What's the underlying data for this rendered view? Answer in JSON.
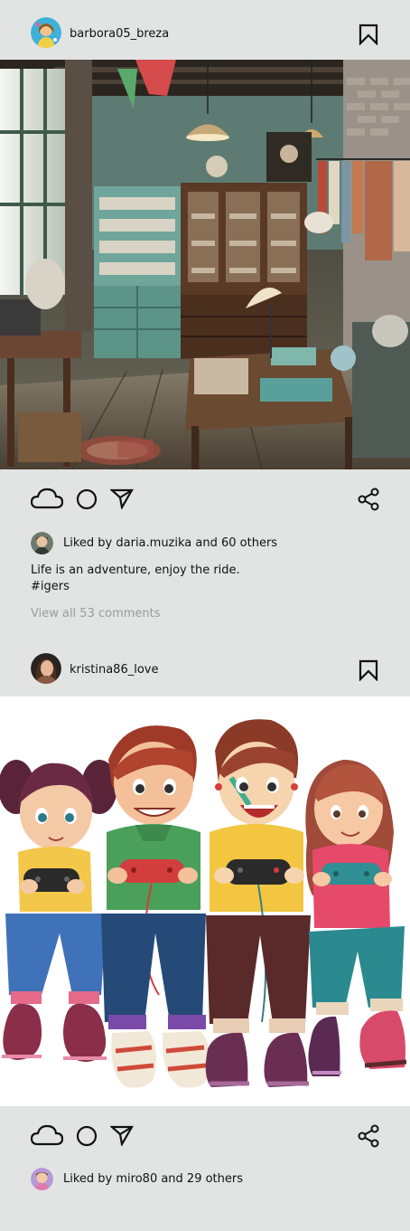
{
  "posts": [
    {
      "username": "barbora05_breza",
      "image_alt": "Vintage antique shop interior",
      "likes_text": "Liked by daria.muzika and 60 others",
      "caption_line1": "Life is an adventure, enjoy the ride.",
      "caption_line2": "#igers",
      "comments_link": "View all 53 comments"
    },
    {
      "username": "kristina86_love",
      "image_alt": "Four cartoon kids playing video games",
      "likes_text": "Liked by miro80 and 29 others"
    }
  ],
  "colors": {
    "background": "#e2e4e3",
    "text": "#111111",
    "muted": "#9a9c9c"
  },
  "icons": [
    "bookmark-icon",
    "cloud-icon",
    "circle-icon",
    "send-icon",
    "share-icon"
  ]
}
